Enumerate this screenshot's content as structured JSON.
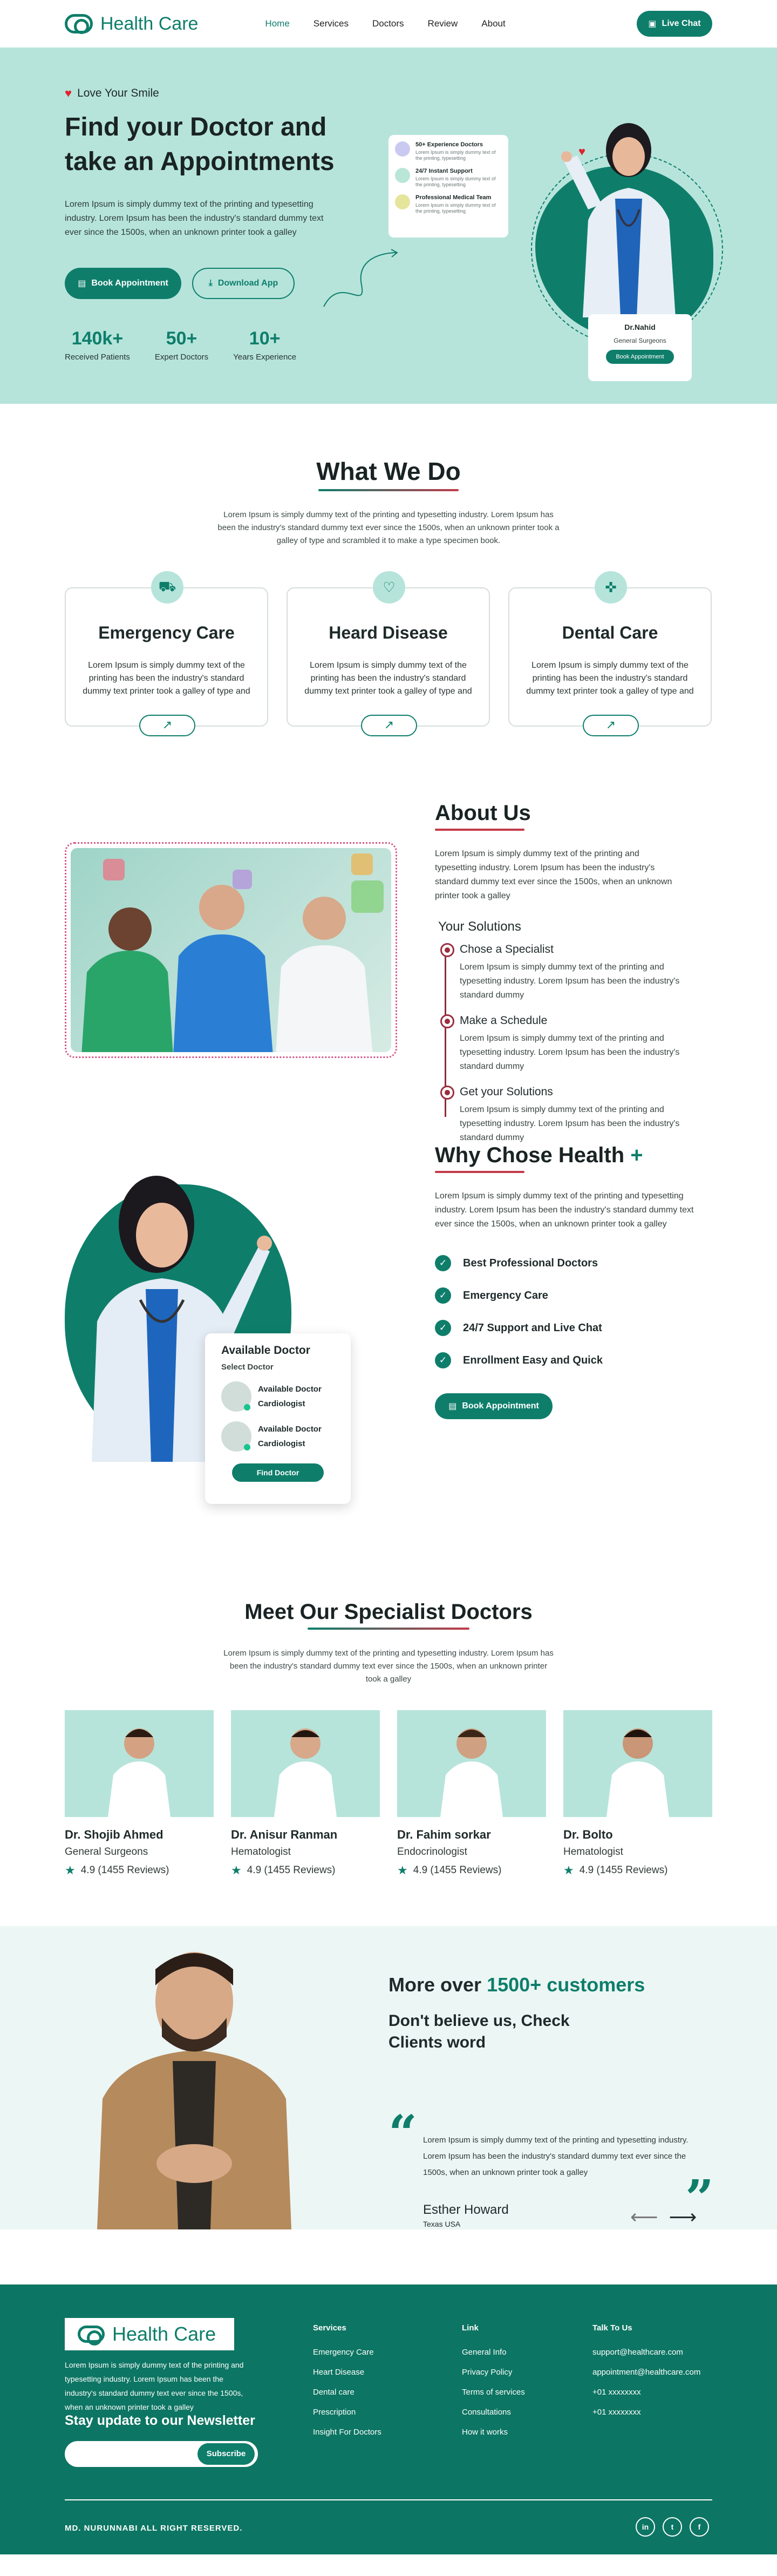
{
  "brand": {
    "name": "Health Care",
    "accent": "#0e7e6b",
    "mint": "#b6e4db",
    "accent_red": "#c23b4a"
  },
  "nav": {
    "items": [
      "Home",
      "Services",
      "Doctors",
      "Review",
      "About"
    ],
    "active": "Home",
    "chat_label": "Live Chat"
  },
  "hero": {
    "tagline": "Love Your Smile",
    "title": "Find your Doctor and take an Appointments",
    "description": "Lorem Ipsum is simply dummy text of the printing and typesetting industry. Lorem Ipsum has been the industry's standard dummy text ever since the 1500s, when an unknown printer took a galley",
    "book_label": "Book Appointment",
    "download_label": "Download App",
    "stats": [
      {
        "num": "140k+",
        "label": "Received Patients"
      },
      {
        "num": "50+",
        "label": "Expert Doctors"
      },
      {
        "num": "10+",
        "label": "Years Experience"
      }
    ],
    "features": [
      {
        "title": "50+ Experience Doctors",
        "text": "Lorem Ipsum is simply dummy text of the printing, typesetting"
      },
      {
        "title": "24/7 Instant Support",
        "text": "Lorem Ipsum is simply dummy text of the printing, typesetting"
      },
      {
        "title": "Professional Medical Team",
        "text": "Lorem Ipsum is simply dummy text of the printing, typesetting"
      }
    ],
    "doctor": {
      "name": "Dr.Nahid",
      "role": "General Surgeons",
      "btn": "Book Appointment"
    }
  },
  "what": {
    "title": "What We Do",
    "desc": "Lorem Ipsum is simply dummy text of the printing and typesetting industry. Lorem Ipsum has been the industry's standard dummy text ever since the 1500s, when an unknown printer took a galley of type and scrambled it to make a type specimen book.",
    "services": [
      {
        "title": "Emergency Care",
        "text": "Lorem Ipsum is simply dummy text of the printing has been the industry's standard dummy text printer took a galley of type and"
      },
      {
        "title": "Heard Disease",
        "text": "Lorem Ipsum is simply dummy text of the printing has been the industry's standard dummy text printer took a galley of type and"
      },
      {
        "title": "Dental Care",
        "text": "Lorem Ipsum is simply dummy text of the printing has been the industry's standard dummy text printer took a galley of type and"
      }
    ]
  },
  "about": {
    "title": "About Us",
    "lead": "Lorem Ipsum is simply dummy text of the printing and typesetting industry. Lorem Ipsum has been the industry's standard dummy text ever since the 1500s, when an unknown printer took a galley",
    "solutions_title": "Your Solutions",
    "steps": [
      {
        "title": "Chose a Specialist",
        "text": "Lorem Ipsum is simply dummy text of the printing and typesetting industry. Lorem Ipsum has been the industry's standard dummy"
      },
      {
        "title": "Make a Schedule",
        "text": "Lorem Ipsum is simply dummy text of the printing and typesetting industry. Lorem Ipsum has been the industry's standard dummy"
      },
      {
        "title": "Get your Solutions",
        "text": "Lorem Ipsum is simply dummy text of the printing and typesetting industry. Lorem Ipsum has been the industry's standard dummy"
      }
    ]
  },
  "why": {
    "title": "Why Chose Health",
    "plus": "+",
    "lead": "Lorem Ipsum is simply dummy text of the printing and typesetting industry. Lorem Ipsum has been the industry's standard dummy text ever since the 1500s, when an unknown printer took a galley",
    "list": [
      "Best Professional Doctors",
      "Emergency Care",
      "24/7 Support and Live Chat",
      "Enrollment Easy and Quick"
    ],
    "btn": "Book Appointment",
    "available": {
      "title": "Available Doctor",
      "sub": "Select Doctor",
      "doctors": [
        {
          "status": "Available Doctor",
          "role": "Cardiologist"
        },
        {
          "status": "Available Doctor",
          "role": "Cardiologist"
        }
      ],
      "find": "Find Doctor"
    }
  },
  "team": {
    "title": "Meet Our Specialist Doctors",
    "desc": "Lorem Ipsum is simply dummy text of the printing and typesetting industry. Lorem Ipsum has been the industry's standard dummy text ever since the 1500s, when an unknown printer took a galley",
    "doctors": [
      {
        "name": "Dr. Shojib Ahmed",
        "role": "General Surgeons",
        "rating": "4.9 (1455 Reviews)"
      },
      {
        "name": "Dr. Anisur Ranman",
        "role": "Hematologist",
        "rating": "4.9 (1455 Reviews)"
      },
      {
        "name": "Dr. Fahim sorkar",
        "role": "Endocrinologist",
        "rating": "4.9 (1455 Reviews)"
      },
      {
        "name": "Dr. Bolto",
        "role": "Hematologist",
        "rating": "4.9 (1455 Reviews)"
      }
    ]
  },
  "testimonial": {
    "more": "More over",
    "count": "1500+ customers",
    "sub": "Don't believe us, Check Clients word",
    "body": "Lorem Ipsum is simply dummy text of the printing and typesetting industry. Lorem Ipsum has been the industry's standard dummy text ever since the 1500s, when an unknown printer took a galley",
    "name": "Esther Howard",
    "loc": "Texas USA"
  },
  "footer": {
    "about": "Lorem Ipsum is simply dummy text of the printing and typesetting industry. Lorem Ipsum has been the industry's standard dummy text ever since the 1500s, when an unknown printer took a galley",
    "newsletter": "Stay update to our Newsletter",
    "subscribe": "Subscribe",
    "cols": [
      {
        "title": "Services",
        "items": [
          "Emergency Care",
          "Heart Disease",
          "Dental care",
          "Prescription",
          "Insight For Doctors"
        ]
      },
      {
        "title": "Link",
        "items": [
          "General Info",
          "Privacy Policy",
          "Terms of services",
          "Consultations",
          "How it works"
        ]
      },
      {
        "title": "Talk To Us",
        "items": [
          "support@healthcare.com",
          "appointment@healthcare.com",
          "+01 xxxxxxxx",
          "+01 xxxxxxxx"
        ]
      }
    ],
    "copyright": "MD. NURUNNABI ALL RIGHT RESERVED.",
    "social": [
      "in",
      "t",
      "f"
    ]
  }
}
